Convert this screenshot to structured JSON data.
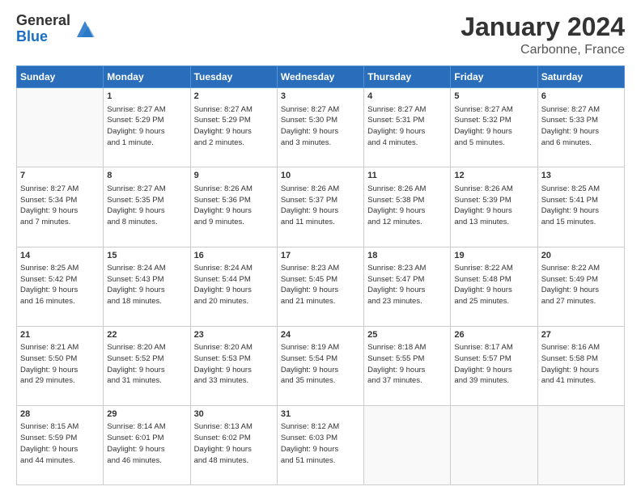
{
  "header": {
    "logo_general": "General",
    "logo_blue": "Blue",
    "month": "January 2024",
    "location": "Carbonne, France"
  },
  "days_of_week": [
    "Sunday",
    "Monday",
    "Tuesday",
    "Wednesday",
    "Thursday",
    "Friday",
    "Saturday"
  ],
  "weeks": [
    [
      {
        "day": "",
        "info": ""
      },
      {
        "day": "1",
        "info": "Sunrise: 8:27 AM\nSunset: 5:29 PM\nDaylight: 9 hours\nand 1 minute."
      },
      {
        "day": "2",
        "info": "Sunrise: 8:27 AM\nSunset: 5:29 PM\nDaylight: 9 hours\nand 2 minutes."
      },
      {
        "day": "3",
        "info": "Sunrise: 8:27 AM\nSunset: 5:30 PM\nDaylight: 9 hours\nand 3 minutes."
      },
      {
        "day": "4",
        "info": "Sunrise: 8:27 AM\nSunset: 5:31 PM\nDaylight: 9 hours\nand 4 minutes."
      },
      {
        "day": "5",
        "info": "Sunrise: 8:27 AM\nSunset: 5:32 PM\nDaylight: 9 hours\nand 5 minutes."
      },
      {
        "day": "6",
        "info": "Sunrise: 8:27 AM\nSunset: 5:33 PM\nDaylight: 9 hours\nand 6 minutes."
      }
    ],
    [
      {
        "day": "7",
        "info": "Sunrise: 8:27 AM\nSunset: 5:34 PM\nDaylight: 9 hours\nand 7 minutes."
      },
      {
        "day": "8",
        "info": "Sunrise: 8:27 AM\nSunset: 5:35 PM\nDaylight: 9 hours\nand 8 minutes."
      },
      {
        "day": "9",
        "info": "Sunrise: 8:26 AM\nSunset: 5:36 PM\nDaylight: 9 hours\nand 9 minutes."
      },
      {
        "day": "10",
        "info": "Sunrise: 8:26 AM\nSunset: 5:37 PM\nDaylight: 9 hours\nand 11 minutes."
      },
      {
        "day": "11",
        "info": "Sunrise: 8:26 AM\nSunset: 5:38 PM\nDaylight: 9 hours\nand 12 minutes."
      },
      {
        "day": "12",
        "info": "Sunrise: 8:26 AM\nSunset: 5:39 PM\nDaylight: 9 hours\nand 13 minutes."
      },
      {
        "day": "13",
        "info": "Sunrise: 8:25 AM\nSunset: 5:41 PM\nDaylight: 9 hours\nand 15 minutes."
      }
    ],
    [
      {
        "day": "14",
        "info": "Sunrise: 8:25 AM\nSunset: 5:42 PM\nDaylight: 9 hours\nand 16 minutes."
      },
      {
        "day": "15",
        "info": "Sunrise: 8:24 AM\nSunset: 5:43 PM\nDaylight: 9 hours\nand 18 minutes."
      },
      {
        "day": "16",
        "info": "Sunrise: 8:24 AM\nSunset: 5:44 PM\nDaylight: 9 hours\nand 20 minutes."
      },
      {
        "day": "17",
        "info": "Sunrise: 8:23 AM\nSunset: 5:45 PM\nDaylight: 9 hours\nand 21 minutes."
      },
      {
        "day": "18",
        "info": "Sunrise: 8:23 AM\nSunset: 5:47 PM\nDaylight: 9 hours\nand 23 minutes."
      },
      {
        "day": "19",
        "info": "Sunrise: 8:22 AM\nSunset: 5:48 PM\nDaylight: 9 hours\nand 25 minutes."
      },
      {
        "day": "20",
        "info": "Sunrise: 8:22 AM\nSunset: 5:49 PM\nDaylight: 9 hours\nand 27 minutes."
      }
    ],
    [
      {
        "day": "21",
        "info": "Sunrise: 8:21 AM\nSunset: 5:50 PM\nDaylight: 9 hours\nand 29 minutes."
      },
      {
        "day": "22",
        "info": "Sunrise: 8:20 AM\nSunset: 5:52 PM\nDaylight: 9 hours\nand 31 minutes."
      },
      {
        "day": "23",
        "info": "Sunrise: 8:20 AM\nSunset: 5:53 PM\nDaylight: 9 hours\nand 33 minutes."
      },
      {
        "day": "24",
        "info": "Sunrise: 8:19 AM\nSunset: 5:54 PM\nDaylight: 9 hours\nand 35 minutes."
      },
      {
        "day": "25",
        "info": "Sunrise: 8:18 AM\nSunset: 5:55 PM\nDaylight: 9 hours\nand 37 minutes."
      },
      {
        "day": "26",
        "info": "Sunrise: 8:17 AM\nSunset: 5:57 PM\nDaylight: 9 hours\nand 39 minutes."
      },
      {
        "day": "27",
        "info": "Sunrise: 8:16 AM\nSunset: 5:58 PM\nDaylight: 9 hours\nand 41 minutes."
      }
    ],
    [
      {
        "day": "28",
        "info": "Sunrise: 8:15 AM\nSunset: 5:59 PM\nDaylight: 9 hours\nand 44 minutes."
      },
      {
        "day": "29",
        "info": "Sunrise: 8:14 AM\nSunset: 6:01 PM\nDaylight: 9 hours\nand 46 minutes."
      },
      {
        "day": "30",
        "info": "Sunrise: 8:13 AM\nSunset: 6:02 PM\nDaylight: 9 hours\nand 48 minutes."
      },
      {
        "day": "31",
        "info": "Sunrise: 8:12 AM\nSunset: 6:03 PM\nDaylight: 9 hours\nand 51 minutes."
      },
      {
        "day": "",
        "info": ""
      },
      {
        "day": "",
        "info": ""
      },
      {
        "day": "",
        "info": ""
      }
    ]
  ]
}
